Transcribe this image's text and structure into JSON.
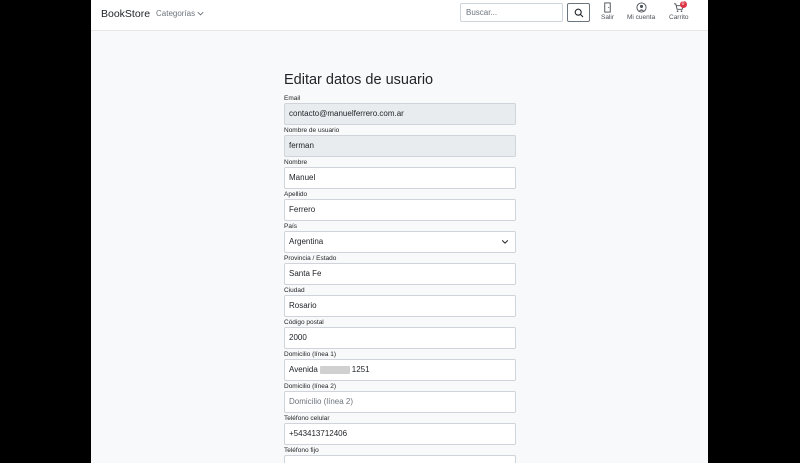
{
  "navbar": {
    "brand": "BookStore",
    "categories_label": "Categorías",
    "search_placeholder": "Buscar...",
    "logout_label": "Salir",
    "account_label": "Mi cuenta",
    "cart_label": "Carrito",
    "cart_count": "0"
  },
  "form": {
    "title": "Editar datos de usuario",
    "fields": {
      "email": {
        "label": "Email",
        "value": "contacto@manuelferrero.com.ar"
      },
      "username": {
        "label": "Nombre de usuario",
        "value": "ferman"
      },
      "first_name": {
        "label": "Nombre",
        "value": "Manuel"
      },
      "last_name": {
        "label": "Apellido",
        "value": "Ferrero"
      },
      "country": {
        "label": "País",
        "value": "Argentina"
      },
      "province": {
        "label": "Provincia / Estado",
        "value": "Santa Fe"
      },
      "city": {
        "label": "Ciudad",
        "value": "Rosario"
      },
      "postal_code": {
        "label": "Código postal",
        "value": "2000"
      },
      "address1": {
        "label": "Domicilio (línea 1)",
        "value_prefix": "Avenida",
        "value_suffix": "1251"
      },
      "address2": {
        "label": "Domicilio (línea 2)",
        "placeholder": "Domicilio (línea 2)"
      },
      "mobile": {
        "label": "Teléfono celular",
        "value": "+543413712406"
      },
      "landline": {
        "label": "Teléfono fijo"
      }
    }
  },
  "colors": {
    "badge": "#dc3545",
    "readonly_bg": "#e9ecef"
  }
}
